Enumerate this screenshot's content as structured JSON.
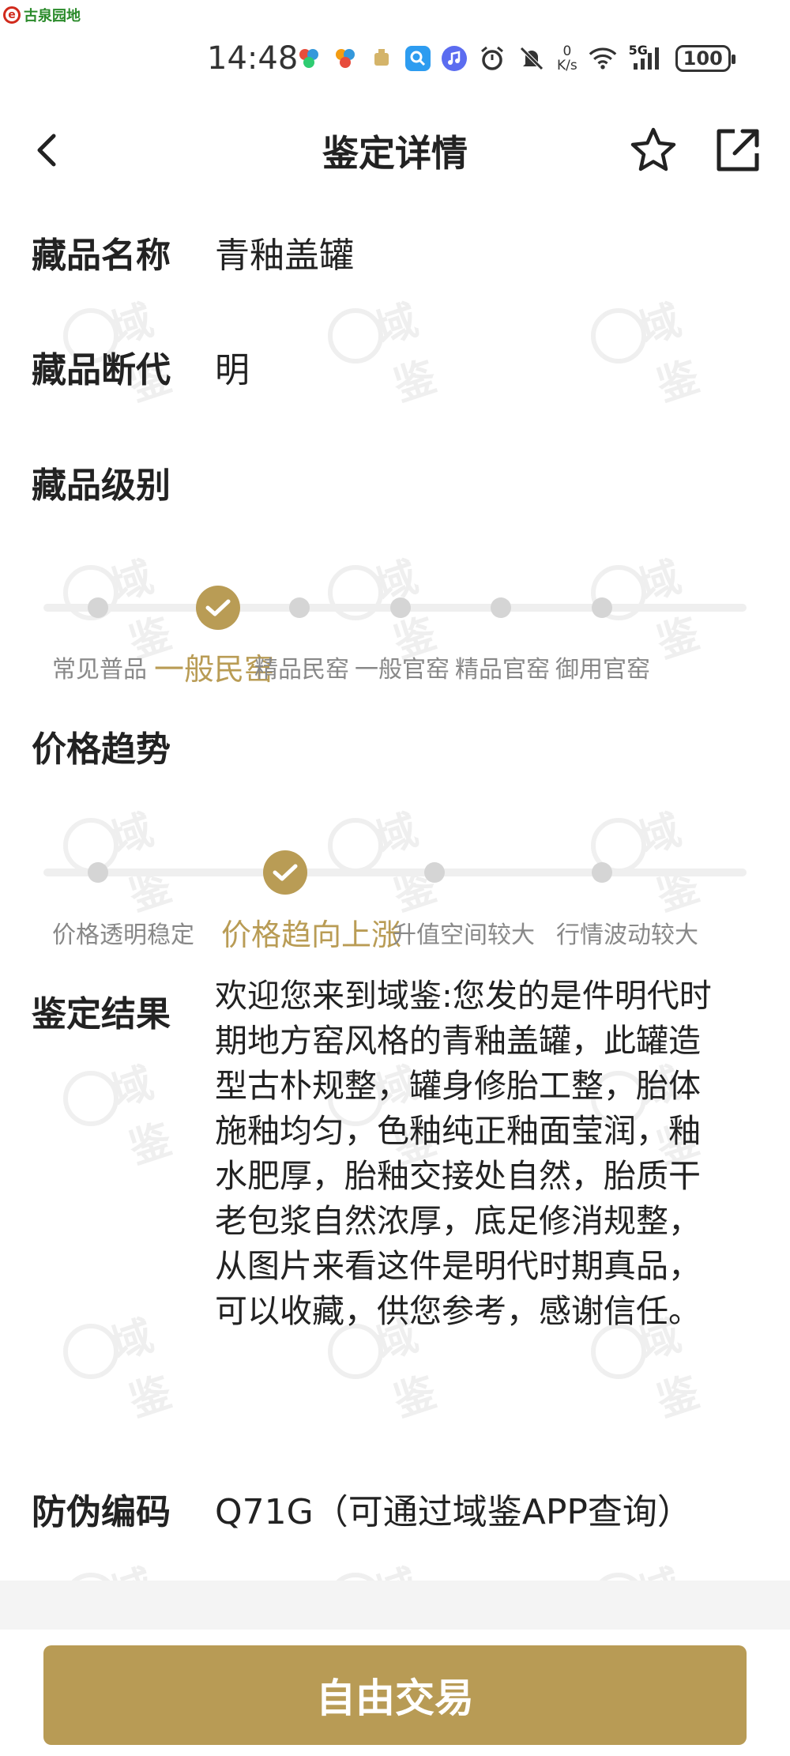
{
  "brand": {
    "name": "古泉园地"
  },
  "status_bar": {
    "time": "14:48",
    "speed_value": "0",
    "speed_unit": "K/s",
    "network": "5G",
    "battery": "100"
  },
  "header": {
    "title": "鉴定详情"
  },
  "fields": {
    "name": {
      "label": "藏品名称",
      "value": "青釉盖罐"
    },
    "dynasty": {
      "label": "藏品断代",
      "value": "明"
    },
    "grade": {
      "label": "藏品级别"
    },
    "trend": {
      "label": "价格趋势"
    },
    "result": {
      "label": "鉴定结果",
      "value": "欢迎您来到域鉴:您发的是件明代时期地方窑风格的青釉盖罐，此罐造型古朴规整，罐身修胎工整，胎体施釉均匀，色釉纯正釉面莹润，釉水肥厚，胎釉交接处自然，胎质干老包浆自然浓厚，底足修消规整，从图片来看这件是明代时期真品，可以收藏，供您参考，感谢信任。"
    },
    "code": {
      "label": "防伪编码",
      "value": "Q71G（可通过域鉴APP查询）"
    }
  },
  "grade_scale": {
    "options": [
      "常见普品",
      "一般民窑",
      "精品民窑",
      "一般官窑",
      "精品官窑",
      "御用官窑"
    ],
    "selected_index": 1
  },
  "trend_scale": {
    "options": [
      "价格透明稳定",
      "价格趋向上涨",
      "升值空间较大",
      "行情波动较大"
    ],
    "selected_index": 1
  },
  "bottom": {
    "button_label": "自由交易"
  },
  "watermark_text": "域鉴",
  "colors": {
    "accent": "#b99c55",
    "track": "#efefef",
    "dot": "#d5d5d5"
  },
  "icons": [
    "back-arrow-icon",
    "star-icon",
    "share-icon",
    "check-icon",
    "alarm-icon",
    "mute-icon",
    "wifi-icon",
    "signal-icon",
    "battery-icon"
  ]
}
